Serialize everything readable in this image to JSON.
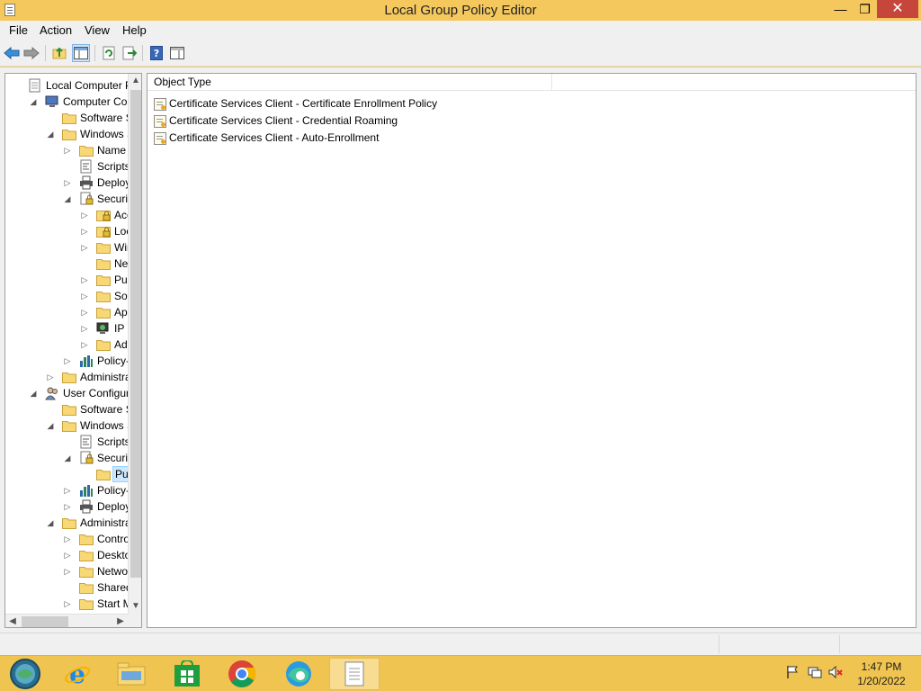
{
  "window": {
    "title": "Local Group Policy Editor"
  },
  "menu": {
    "file": "File",
    "action": "Action",
    "view": "View",
    "help": "Help"
  },
  "toolbar": {
    "buttons": [
      "back-icon",
      "forward-icon",
      "up-folder-icon",
      "show-hide-tree-icon",
      "refresh-icon",
      "export-list-icon",
      "help-icon",
      "properties-pane-icon"
    ]
  },
  "tree": {
    "items": [
      {
        "label": "Local Computer Polic",
        "icon": "policy-doc-icon"
      },
      {
        "label": "Computer Config",
        "icon": "computer-icon"
      },
      {
        "label": "Software Setti",
        "icon": "folder-icon"
      },
      {
        "label": "Windows Sett",
        "icon": "folder-icon"
      },
      {
        "label": "Name Res",
        "icon": "folder-icon"
      },
      {
        "label": "Scripts (Sta",
        "icon": "script-icon"
      },
      {
        "label": "Deployed",
        "icon": "printer-icon"
      },
      {
        "label": "Security Se",
        "icon": "security-icon"
      },
      {
        "label": "Accou",
        "icon": "lock-folder-icon"
      },
      {
        "label": "Local P",
        "icon": "lock-folder-icon"
      },
      {
        "label": "Windo",
        "icon": "folder-icon"
      },
      {
        "label": "Netwo",
        "icon": "folder-icon"
      },
      {
        "label": "Public",
        "icon": "folder-icon"
      },
      {
        "label": "Softwa",
        "icon": "folder-icon"
      },
      {
        "label": "Applic",
        "icon": "folder-icon"
      },
      {
        "label": "IP Secu",
        "icon": "ip-security-icon"
      },
      {
        "label": "Advan",
        "icon": "folder-icon"
      },
      {
        "label": "Policy-bas",
        "icon": "chart-icon"
      },
      {
        "label": "Administrativ",
        "icon": "folder-icon"
      },
      {
        "label": "User Configuratio",
        "icon": "users-icon"
      },
      {
        "label": "Software Setti",
        "icon": "folder-icon"
      },
      {
        "label": "Windows Sett",
        "icon": "folder-icon"
      },
      {
        "label": "Scripts (Lo",
        "icon": "script-icon"
      },
      {
        "label": "Security Se",
        "icon": "security-icon"
      },
      {
        "label": "Public",
        "icon": "folder-icon"
      },
      {
        "label": "Policy-bas",
        "icon": "chart-icon"
      },
      {
        "label": "Deployed",
        "icon": "printer-icon"
      },
      {
        "label": "Administrativ",
        "icon": "folder-icon"
      },
      {
        "label": "Control Pa",
        "icon": "folder-icon"
      },
      {
        "label": "Desktop",
        "icon": "folder-icon"
      },
      {
        "label": "Network",
        "icon": "folder-icon"
      },
      {
        "label": "Shared Fol",
        "icon": "folder-icon"
      },
      {
        "label": "Start Menu",
        "icon": "folder-icon"
      }
    ]
  },
  "content": {
    "column_header": "Object Type",
    "rows": [
      "Certificate Services Client - Certificate Enrollment Policy",
      "Certificate Services Client - Credential Roaming",
      "Certificate Services Client - Auto-Enrollment"
    ]
  },
  "taskbar": {
    "items": [
      "start-button-icon",
      "internet-explorer-icon",
      "file-explorer-icon",
      "store-icon",
      "chrome-icon",
      "edge-icon",
      "notepad-policy-icon"
    ],
    "clock_time": "1:47 PM",
    "clock_date": "1/20/2022"
  },
  "colors": {
    "accent": "#f0c451",
    "selection": "#cce8ff",
    "close": "#c7463c"
  }
}
